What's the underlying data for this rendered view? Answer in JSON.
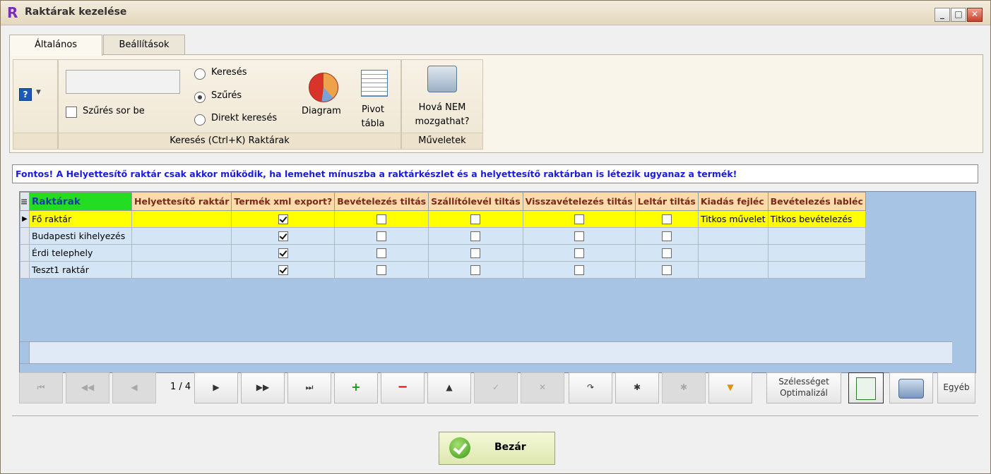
{
  "window": {
    "title": "Raktárak kezelése",
    "logo_letter": "R",
    "minimize_label": "_",
    "maximize_label": "□",
    "close_label": "✕"
  },
  "tabs": [
    {
      "label": "Általános",
      "active": true
    },
    {
      "label": "Beállítások",
      "active": false
    }
  ],
  "ribbon": {
    "search_input_value": "",
    "filter_row_label": "Szűrés sor be",
    "radio_options": [
      {
        "label": "Keresés",
        "selected": false
      },
      {
        "label": "Szűrés",
        "selected": true
      },
      {
        "label": "Direkt keresés",
        "selected": false
      }
    ],
    "diagram_label": "Diagram",
    "pivot_label_1": "Pivot",
    "pivot_label_2": "tábla",
    "search_group_label": "Keresés (Ctrl+K) Raktárak",
    "move_label_1": "Hová NEM",
    "move_label_2": "mozgathat?",
    "operations_group_label": "Műveletek"
  },
  "notice": "Fontos! A Helyettesítő raktár csak akkor működik, ha lemehet mínuszba a raktárkészlet és a helyettesítő raktárban is létezik ugyanaz a termék!",
  "grid": {
    "columns": [
      "Raktárak",
      "Helyettesítő raktár",
      "Termék xml export?",
      "Bevételezés tiltás",
      "Szállítólevél tiltás",
      "Visszavételezés tiltás",
      "Leltár tiltás",
      "Kiadás fejléc",
      "Bevételezés labléc"
    ],
    "rows": [
      {
        "name": "Fő raktár",
        "substitute": "",
        "xml_export": true,
        "receipt_block": false,
        "delivery_block": false,
        "return_block": false,
        "inventory_block": false,
        "issue_header": "Titkos művelet",
        "receipt_footer": "Titkos bevételezés",
        "selected": true
      },
      {
        "name": "Budapesti kihelyezés",
        "substitute": "",
        "xml_export": true,
        "receipt_block": false,
        "delivery_block": false,
        "return_block": false,
        "inventory_block": false,
        "issue_header": "",
        "receipt_footer": "",
        "selected": false
      },
      {
        "name": "Érdi telephely",
        "substitute": "",
        "xml_export": true,
        "receipt_block": false,
        "delivery_block": false,
        "return_block": false,
        "inventory_block": false,
        "issue_header": "",
        "receipt_footer": "",
        "selected": false
      },
      {
        "name": "Teszt1 raktár",
        "substitute": "",
        "xml_export": true,
        "receipt_block": false,
        "delivery_block": false,
        "return_block": false,
        "inventory_block": false,
        "issue_header": "",
        "receipt_footer": "",
        "selected": false
      }
    ]
  },
  "navigator": {
    "position": "1 / 4",
    "first": "⏮",
    "prev_page": "◀◀",
    "prev": "◀",
    "next": "▶",
    "next_page": "▶▶",
    "last": "⏭",
    "add": "+",
    "remove": "−",
    "up": "▲",
    "confirm": "✓",
    "cancel": "✕",
    "refresh": "↷",
    "bookmark": "✱",
    "goto_bookmark": "✱",
    "filter": "▼",
    "width_opt_1": "Szélességet",
    "width_opt_2": "Optimalizál",
    "other": "Egyéb"
  },
  "close_button": "Bezár",
  "colors": {
    "grid_background": "#a8c4e4",
    "selected_row": "#ffff00",
    "header": "#fddcaa",
    "first_header": "#22dd22",
    "notice_text": "#1a1ae0"
  }
}
